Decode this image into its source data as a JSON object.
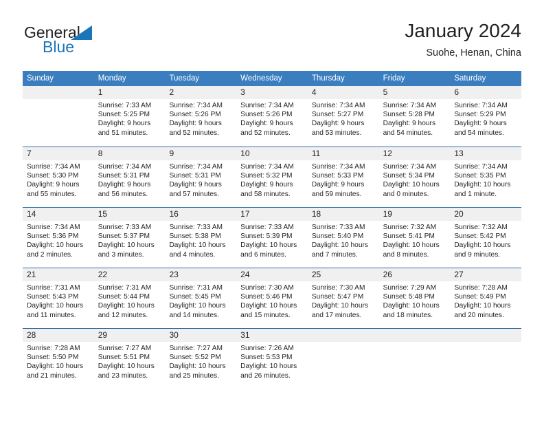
{
  "logo": {
    "word1": "General",
    "word2": "Blue",
    "triangle_color": "#1b75bb",
    "icon": "general-blue-logo"
  },
  "header": {
    "title": "January 2024",
    "subtitle": "Suohe, Henan, China"
  },
  "theme": {
    "header_blue": "#3a7ebf",
    "divider_blue": "#2e6da4",
    "day_band_gray": "#f0f0f0",
    "text": "#231f20"
  },
  "weekdays": [
    "Sunday",
    "Monday",
    "Tuesday",
    "Wednesday",
    "Thursday",
    "Friday",
    "Saturday"
  ],
  "weeks": [
    [
      {
        "day": "",
        "sunrise": "",
        "sunset": "",
        "daylight1": "",
        "daylight2": ""
      },
      {
        "day": "1",
        "sunrise": "Sunrise: 7:33 AM",
        "sunset": "Sunset: 5:25 PM",
        "daylight1": "Daylight: 9 hours",
        "daylight2": "and 51 minutes."
      },
      {
        "day": "2",
        "sunrise": "Sunrise: 7:34 AM",
        "sunset": "Sunset: 5:26 PM",
        "daylight1": "Daylight: 9 hours",
        "daylight2": "and 52 minutes."
      },
      {
        "day": "3",
        "sunrise": "Sunrise: 7:34 AM",
        "sunset": "Sunset: 5:26 PM",
        "daylight1": "Daylight: 9 hours",
        "daylight2": "and 52 minutes."
      },
      {
        "day": "4",
        "sunrise": "Sunrise: 7:34 AM",
        "sunset": "Sunset: 5:27 PM",
        "daylight1": "Daylight: 9 hours",
        "daylight2": "and 53 minutes."
      },
      {
        "day": "5",
        "sunrise": "Sunrise: 7:34 AM",
        "sunset": "Sunset: 5:28 PM",
        "daylight1": "Daylight: 9 hours",
        "daylight2": "and 54 minutes."
      },
      {
        "day": "6",
        "sunrise": "Sunrise: 7:34 AM",
        "sunset": "Sunset: 5:29 PM",
        "daylight1": "Daylight: 9 hours",
        "daylight2": "and 54 minutes."
      }
    ],
    [
      {
        "day": "7",
        "sunrise": "Sunrise: 7:34 AM",
        "sunset": "Sunset: 5:30 PM",
        "daylight1": "Daylight: 9 hours",
        "daylight2": "and 55 minutes."
      },
      {
        "day": "8",
        "sunrise": "Sunrise: 7:34 AM",
        "sunset": "Sunset: 5:31 PM",
        "daylight1": "Daylight: 9 hours",
        "daylight2": "and 56 minutes."
      },
      {
        "day": "9",
        "sunrise": "Sunrise: 7:34 AM",
        "sunset": "Sunset: 5:31 PM",
        "daylight1": "Daylight: 9 hours",
        "daylight2": "and 57 minutes."
      },
      {
        "day": "10",
        "sunrise": "Sunrise: 7:34 AM",
        "sunset": "Sunset: 5:32 PM",
        "daylight1": "Daylight: 9 hours",
        "daylight2": "and 58 minutes."
      },
      {
        "day": "11",
        "sunrise": "Sunrise: 7:34 AM",
        "sunset": "Sunset: 5:33 PM",
        "daylight1": "Daylight: 9 hours",
        "daylight2": "and 59 minutes."
      },
      {
        "day": "12",
        "sunrise": "Sunrise: 7:34 AM",
        "sunset": "Sunset: 5:34 PM",
        "daylight1": "Daylight: 10 hours",
        "daylight2": "and 0 minutes."
      },
      {
        "day": "13",
        "sunrise": "Sunrise: 7:34 AM",
        "sunset": "Sunset: 5:35 PM",
        "daylight1": "Daylight: 10 hours",
        "daylight2": "and 1 minute."
      }
    ],
    [
      {
        "day": "14",
        "sunrise": "Sunrise: 7:34 AM",
        "sunset": "Sunset: 5:36 PM",
        "daylight1": "Daylight: 10 hours",
        "daylight2": "and 2 minutes."
      },
      {
        "day": "15",
        "sunrise": "Sunrise: 7:33 AM",
        "sunset": "Sunset: 5:37 PM",
        "daylight1": "Daylight: 10 hours",
        "daylight2": "and 3 minutes."
      },
      {
        "day": "16",
        "sunrise": "Sunrise: 7:33 AM",
        "sunset": "Sunset: 5:38 PM",
        "daylight1": "Daylight: 10 hours",
        "daylight2": "and 4 minutes."
      },
      {
        "day": "17",
        "sunrise": "Sunrise: 7:33 AM",
        "sunset": "Sunset: 5:39 PM",
        "daylight1": "Daylight: 10 hours",
        "daylight2": "and 6 minutes."
      },
      {
        "day": "18",
        "sunrise": "Sunrise: 7:33 AM",
        "sunset": "Sunset: 5:40 PM",
        "daylight1": "Daylight: 10 hours",
        "daylight2": "and 7 minutes."
      },
      {
        "day": "19",
        "sunrise": "Sunrise: 7:32 AM",
        "sunset": "Sunset: 5:41 PM",
        "daylight1": "Daylight: 10 hours",
        "daylight2": "and 8 minutes."
      },
      {
        "day": "20",
        "sunrise": "Sunrise: 7:32 AM",
        "sunset": "Sunset: 5:42 PM",
        "daylight1": "Daylight: 10 hours",
        "daylight2": "and 9 minutes."
      }
    ],
    [
      {
        "day": "21",
        "sunrise": "Sunrise: 7:31 AM",
        "sunset": "Sunset: 5:43 PM",
        "daylight1": "Daylight: 10 hours",
        "daylight2": "and 11 minutes."
      },
      {
        "day": "22",
        "sunrise": "Sunrise: 7:31 AM",
        "sunset": "Sunset: 5:44 PM",
        "daylight1": "Daylight: 10 hours",
        "daylight2": "and 12 minutes."
      },
      {
        "day": "23",
        "sunrise": "Sunrise: 7:31 AM",
        "sunset": "Sunset: 5:45 PM",
        "daylight1": "Daylight: 10 hours",
        "daylight2": "and 14 minutes."
      },
      {
        "day": "24",
        "sunrise": "Sunrise: 7:30 AM",
        "sunset": "Sunset: 5:46 PM",
        "daylight1": "Daylight: 10 hours",
        "daylight2": "and 15 minutes."
      },
      {
        "day": "25",
        "sunrise": "Sunrise: 7:30 AM",
        "sunset": "Sunset: 5:47 PM",
        "daylight1": "Daylight: 10 hours",
        "daylight2": "and 17 minutes."
      },
      {
        "day": "26",
        "sunrise": "Sunrise: 7:29 AM",
        "sunset": "Sunset: 5:48 PM",
        "daylight1": "Daylight: 10 hours",
        "daylight2": "and 18 minutes."
      },
      {
        "day": "27",
        "sunrise": "Sunrise: 7:28 AM",
        "sunset": "Sunset: 5:49 PM",
        "daylight1": "Daylight: 10 hours",
        "daylight2": "and 20 minutes."
      }
    ],
    [
      {
        "day": "28",
        "sunrise": "Sunrise: 7:28 AM",
        "sunset": "Sunset: 5:50 PM",
        "daylight1": "Daylight: 10 hours",
        "daylight2": "and 21 minutes."
      },
      {
        "day": "29",
        "sunrise": "Sunrise: 7:27 AM",
        "sunset": "Sunset: 5:51 PM",
        "daylight1": "Daylight: 10 hours",
        "daylight2": "and 23 minutes."
      },
      {
        "day": "30",
        "sunrise": "Sunrise: 7:27 AM",
        "sunset": "Sunset: 5:52 PM",
        "daylight1": "Daylight: 10 hours",
        "daylight2": "and 25 minutes."
      },
      {
        "day": "31",
        "sunrise": "Sunrise: 7:26 AM",
        "sunset": "Sunset: 5:53 PM",
        "daylight1": "Daylight: 10 hours",
        "daylight2": "and 26 minutes."
      },
      {
        "day": "",
        "sunrise": "",
        "sunset": "",
        "daylight1": "",
        "daylight2": ""
      },
      {
        "day": "",
        "sunrise": "",
        "sunset": "",
        "daylight1": "",
        "daylight2": ""
      },
      {
        "day": "",
        "sunrise": "",
        "sunset": "",
        "daylight1": "",
        "daylight2": ""
      }
    ]
  ]
}
